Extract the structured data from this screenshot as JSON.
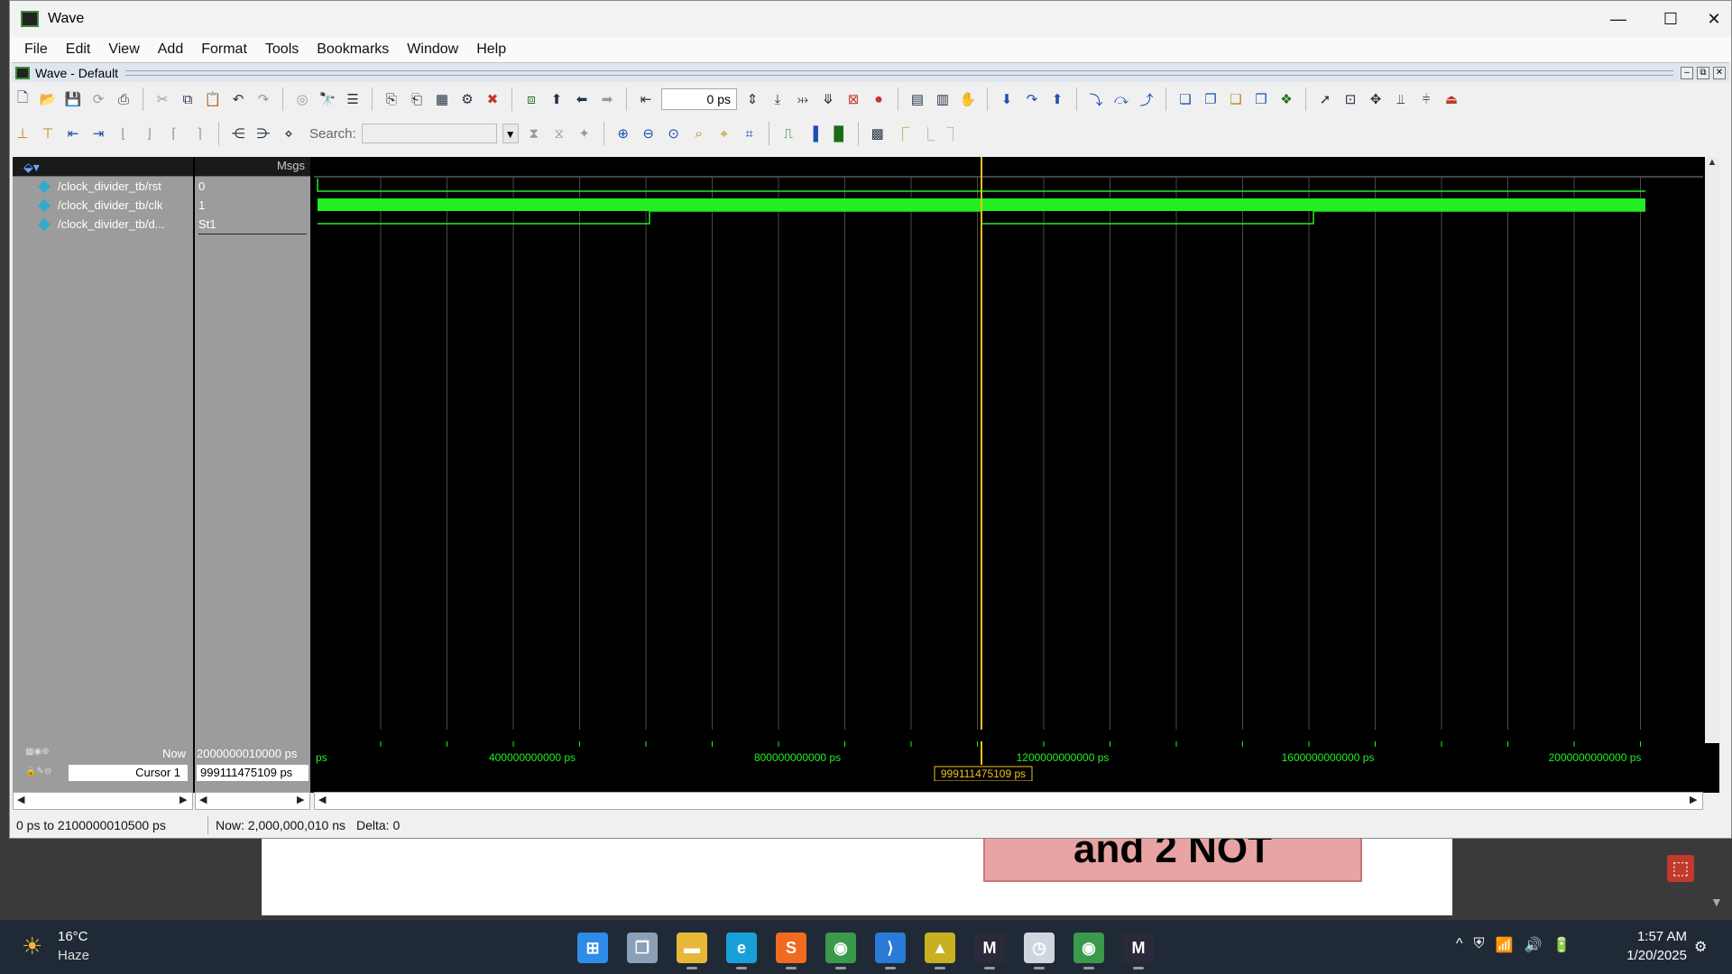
{
  "window": {
    "title": "Wave",
    "controls": {
      "minimize": "—",
      "maximize": "☐",
      "close": "✕"
    }
  },
  "menubar": [
    "File",
    "Edit",
    "View",
    "Add",
    "Format",
    "Tools",
    "Bookmarks",
    "Window",
    "Help"
  ],
  "subwindow": {
    "title": "Wave - Default",
    "min": "–",
    "float": "⧉",
    "close": "✕"
  },
  "toolbar1": {
    "time_value": "0 ps"
  },
  "toolbar2": {
    "search_label": "Search:",
    "search_value": "",
    "search_dropdown": "▼"
  },
  "panes": {
    "values_header": "Msgs",
    "signals": [
      {
        "name": "/clock_divider_tb/rst",
        "value": "0"
      },
      {
        "name": "/clock_divider_tb/clk",
        "value": "1"
      },
      {
        "name": "/clock_divider_tb/d...",
        "value": "St1"
      }
    ],
    "now_label": "Now",
    "now_value": "2000000010000 ps",
    "cursor_label": "Cursor 1",
    "cursor_value": "999111475109 ps"
  },
  "timeline": {
    "start_label": "ps",
    "ticks": [
      "400000000000 ps",
      "800000000000 ps",
      "1200000000000 ps",
      "1600000000000 ps",
      "2000000000000 ps"
    ],
    "cursor_readout": "999111475109 ps"
  },
  "wave_colors": {
    "signal": "#22ee22",
    "cursor": "#f0c020",
    "grid": "#4a4a4a"
  },
  "statusbar": {
    "range": "0 ps to 2100000010500 ps",
    "now": "Now: 2,000,000,010 ns",
    "delta": "Delta: 0"
  },
  "background_doc": {
    "banner_text": "and 2 NOT"
  },
  "taskbar": {
    "weather_temp": "16°C",
    "weather_desc": "Haze",
    "apps": [
      {
        "name": "start",
        "glyph": "⊞",
        "color": "#2f8be8"
      },
      {
        "name": "task-view",
        "glyph": "❐",
        "color": "#8aa0b8"
      },
      {
        "name": "file-explorer",
        "glyph": "▬",
        "color": "#e8b73a"
      },
      {
        "name": "edge",
        "glyph": "e",
        "color": "#1aa0d8"
      },
      {
        "name": "sublime",
        "glyph": "S",
        "color": "#f06a20"
      },
      {
        "name": "chrome",
        "glyph": "◉",
        "color": "#3a9a4a"
      },
      {
        "name": "vscode",
        "glyph": "⟩",
        "color": "#2a7ad8"
      },
      {
        "name": "app-triangle",
        "glyph": "▲",
        "color": "#c8b020"
      },
      {
        "name": "modelsim-1",
        "glyph": "M",
        "color": "#2a2a3a"
      },
      {
        "name": "clock-app",
        "glyph": "◷",
        "color": "#cfd6de"
      },
      {
        "name": "chrome-2",
        "glyph": "◉",
        "color": "#3a9a4a"
      },
      {
        "name": "modelsim-2",
        "glyph": "M",
        "color": "#2a2a3a"
      }
    ],
    "tray": [
      "^",
      "⛨",
      "📶",
      "🔊",
      "🔋"
    ],
    "time": "1:57 AM",
    "date": "1/20/2025"
  }
}
